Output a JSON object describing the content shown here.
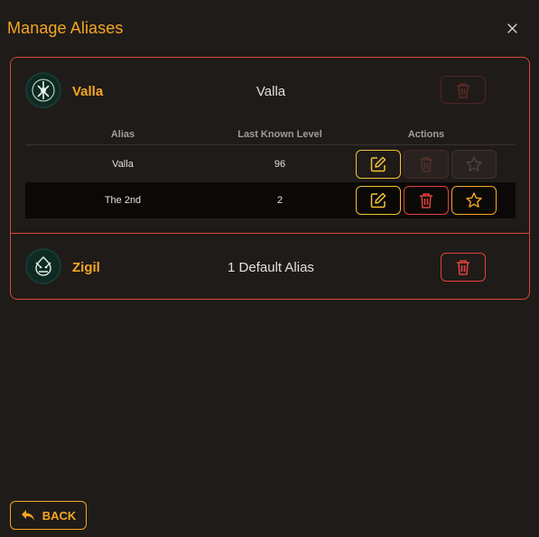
{
  "window": {
    "title": "Manage Aliases",
    "close_glyph": "×"
  },
  "colors": {
    "accent": "#f5a623",
    "danger": "#e0423b",
    "edit": "#f2c230",
    "background": "#1f1b19"
  },
  "characters": [
    {
      "name": "Valla",
      "summary": "Valla",
      "avatar_icon": "valla-portrait-icon",
      "expanded": true,
      "delete_enabled": false,
      "table": {
        "headers": [
          "Alias",
          "Last Known Level",
          "Actions"
        ],
        "rows": [
          {
            "alias": "Valla",
            "level": "96",
            "edit_enabled": true,
            "delete_enabled": false,
            "star_enabled": false
          },
          {
            "alias": "The 2nd",
            "level": "2",
            "edit_enabled": true,
            "delete_enabled": true,
            "star_enabled": true
          }
        ]
      }
    },
    {
      "name": "Zigil",
      "summary": "1 Default Alias",
      "avatar_icon": "zigil-portrait-icon",
      "expanded": false,
      "delete_enabled": true
    }
  ],
  "footer": {
    "back_label": "BACK",
    "back_icon": "back-arrow-icon"
  }
}
